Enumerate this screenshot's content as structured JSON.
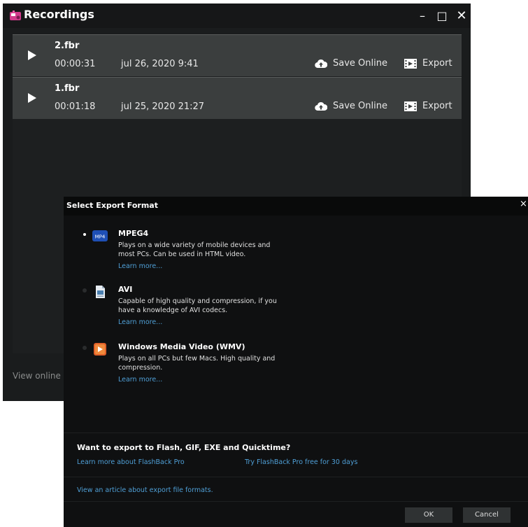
{
  "window": {
    "title": "Recordings",
    "minimize_glyph": "–",
    "maximize_glyph": "□",
    "close_glyph": "✕",
    "accent": "#d23a8c"
  },
  "recordings": [
    {
      "name": "2.fbr",
      "duration": "00:00:31",
      "date": "jul 26, 2020 9:41",
      "save_label": "Save Online",
      "export_label": "Export"
    },
    {
      "name": "1.fbr",
      "duration": "00:01:18",
      "date": "jul 25, 2020 21:27",
      "save_label": "Save Online",
      "export_label": "Export"
    }
  ],
  "footer": {
    "view_online": "View online re"
  },
  "dialog": {
    "title": "Select Export Format",
    "close_glyph": "×",
    "options": [
      {
        "name": "MPEG4",
        "icon_text": "MP4",
        "icon": "mp4-icon",
        "desc": "Plays on a wide variety of mobile devices and most PCs. Can be used in HTML video.",
        "learn": "Learn more...",
        "selected": true
      },
      {
        "name": "AVI",
        "icon": "avi-file-icon",
        "desc": "Capable of high quality and compression, if you have a knowledge of AVI codecs.",
        "learn": "Learn more...",
        "selected": false
      },
      {
        "name": "Windows Media Video (WMV)",
        "icon": "wmv-icon",
        "desc": "Plays on all PCs but few Macs. High quality and compression.",
        "learn": "Learn more...",
        "selected": false
      }
    ],
    "promo": {
      "heading": "Want to export to Flash, GIF, EXE and Quicktime?",
      "learn_pro": "Learn more about FlashBack Pro",
      "try_pro": "Try FlashBack Pro free for 30 days"
    },
    "article_link": "View an article about export file formats.",
    "ok_label": "OK",
    "cancel_label": "Cancel",
    "link_color": "#4f9fd6"
  }
}
